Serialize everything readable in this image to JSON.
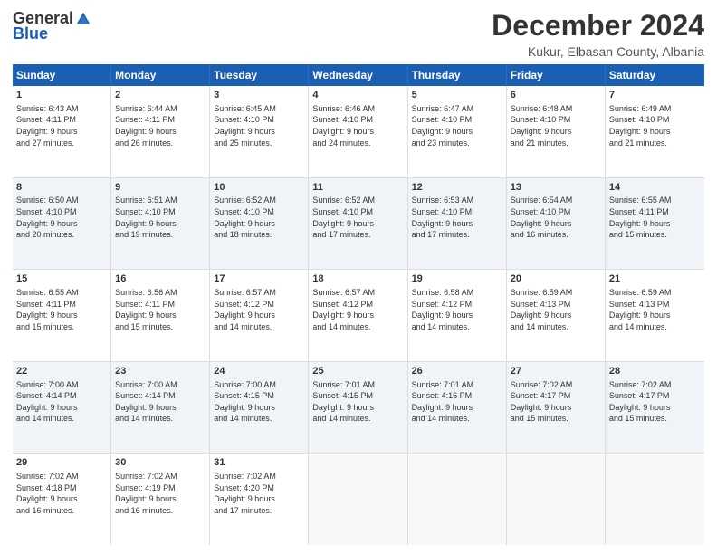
{
  "logo": {
    "general": "General",
    "blue": "Blue"
  },
  "title": {
    "month_year": "December 2024",
    "location": "Kukur, Elbasan County, Albania"
  },
  "days": [
    "Sunday",
    "Monday",
    "Tuesday",
    "Wednesday",
    "Thursday",
    "Friday",
    "Saturday"
  ],
  "rows": [
    [
      {
        "day": 1,
        "sunrise": "6:43 AM",
        "sunset": "4:11 PM",
        "daylight": "9 hours and 27 minutes."
      },
      {
        "day": 2,
        "sunrise": "6:44 AM",
        "sunset": "4:11 PM",
        "daylight": "9 hours and 26 minutes."
      },
      {
        "day": 3,
        "sunrise": "6:45 AM",
        "sunset": "4:10 PM",
        "daylight": "9 hours and 25 minutes."
      },
      {
        "day": 4,
        "sunrise": "6:46 AM",
        "sunset": "4:10 PM",
        "daylight": "9 hours and 24 minutes."
      },
      {
        "day": 5,
        "sunrise": "6:47 AM",
        "sunset": "4:10 PM",
        "daylight": "9 hours and 23 minutes."
      },
      {
        "day": 6,
        "sunrise": "6:48 AM",
        "sunset": "4:10 PM",
        "daylight": "9 hours and 21 minutes."
      },
      {
        "day": 7,
        "sunrise": "6:49 AM",
        "sunset": "4:10 PM",
        "daylight": "9 hours and 21 minutes."
      }
    ],
    [
      {
        "day": 8,
        "sunrise": "6:50 AM",
        "sunset": "4:10 PM",
        "daylight": "9 hours and 20 minutes."
      },
      {
        "day": 9,
        "sunrise": "6:51 AM",
        "sunset": "4:10 PM",
        "daylight": "9 hours and 19 minutes."
      },
      {
        "day": 10,
        "sunrise": "6:52 AM",
        "sunset": "4:10 PM",
        "daylight": "9 hours and 18 minutes."
      },
      {
        "day": 11,
        "sunrise": "6:52 AM",
        "sunset": "4:10 PM",
        "daylight": "9 hours and 17 minutes."
      },
      {
        "day": 12,
        "sunrise": "6:53 AM",
        "sunset": "4:10 PM",
        "daylight": "9 hours and 17 minutes."
      },
      {
        "day": 13,
        "sunrise": "6:54 AM",
        "sunset": "4:10 PM",
        "daylight": "9 hours and 16 minutes."
      },
      {
        "day": 14,
        "sunrise": "6:55 AM",
        "sunset": "4:11 PM",
        "daylight": "9 hours and 15 minutes."
      }
    ],
    [
      {
        "day": 15,
        "sunrise": "6:55 AM",
        "sunset": "4:11 PM",
        "daylight": "9 hours and 15 minutes."
      },
      {
        "day": 16,
        "sunrise": "6:56 AM",
        "sunset": "4:11 PM",
        "daylight": "9 hours and 15 minutes."
      },
      {
        "day": 17,
        "sunrise": "6:57 AM",
        "sunset": "4:12 PM",
        "daylight": "9 hours and 14 minutes."
      },
      {
        "day": 18,
        "sunrise": "6:57 AM",
        "sunset": "4:12 PM",
        "daylight": "9 hours and 14 minutes."
      },
      {
        "day": 19,
        "sunrise": "6:58 AM",
        "sunset": "4:12 PM",
        "daylight": "9 hours and 14 minutes."
      },
      {
        "day": 20,
        "sunrise": "6:59 AM",
        "sunset": "4:13 PM",
        "daylight": "9 hours and 14 minutes."
      },
      {
        "day": 21,
        "sunrise": "6:59 AM",
        "sunset": "4:13 PM",
        "daylight": "9 hours and 14 minutes."
      }
    ],
    [
      {
        "day": 22,
        "sunrise": "7:00 AM",
        "sunset": "4:14 PM",
        "daylight": "9 hours and 14 minutes."
      },
      {
        "day": 23,
        "sunrise": "7:00 AM",
        "sunset": "4:14 PM",
        "daylight": "9 hours and 14 minutes."
      },
      {
        "day": 24,
        "sunrise": "7:00 AM",
        "sunset": "4:15 PM",
        "daylight": "9 hours and 14 minutes."
      },
      {
        "day": 25,
        "sunrise": "7:01 AM",
        "sunset": "4:15 PM",
        "daylight": "9 hours and 14 minutes."
      },
      {
        "day": 26,
        "sunrise": "7:01 AM",
        "sunset": "4:16 PM",
        "daylight": "9 hours and 14 minutes."
      },
      {
        "day": 27,
        "sunrise": "7:02 AM",
        "sunset": "4:17 PM",
        "daylight": "9 hours and 15 minutes."
      },
      {
        "day": 28,
        "sunrise": "7:02 AM",
        "sunset": "4:17 PM",
        "daylight": "9 hours and 15 minutes."
      }
    ],
    [
      {
        "day": 29,
        "sunrise": "7:02 AM",
        "sunset": "4:18 PM",
        "daylight": "9 hours and 16 minutes."
      },
      {
        "day": 30,
        "sunrise": "7:02 AM",
        "sunset": "4:19 PM",
        "daylight": "9 hours and 16 minutes."
      },
      {
        "day": 31,
        "sunrise": "7:02 AM",
        "sunset": "4:20 PM",
        "daylight": "9 hours and 17 minutes."
      },
      null,
      null,
      null,
      null
    ]
  ],
  "labels": {
    "sunrise": "Sunrise:",
    "sunset": "Sunset:",
    "daylight": "Daylight:"
  }
}
